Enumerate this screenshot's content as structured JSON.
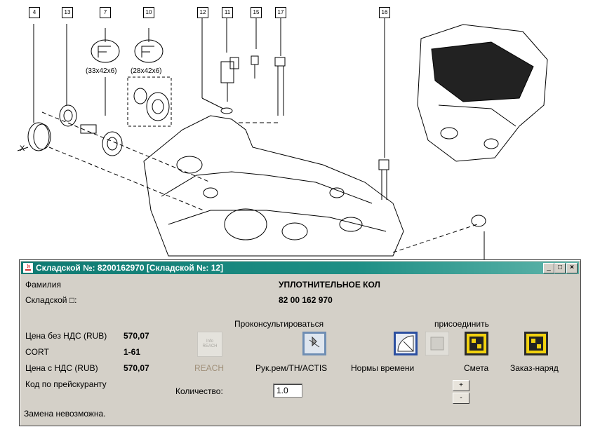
{
  "diagram": {
    "callouts": [
      "4",
      "13",
      "7",
      "10",
      "12",
      "11",
      "15",
      "17",
      "16"
    ],
    "seal_sizes": [
      "(33x42x6)",
      "(28x42x6)"
    ],
    "view_label": "X"
  },
  "dialog": {
    "title": "Складской №: 8200162970 [Складской №: 12]",
    "controls": {
      "minimize": "_",
      "maximize": "□",
      "close": "×"
    },
    "name_label": "Фамилия",
    "name_value": "УПЛОТНИТЕЛЬНОЕ КОЛ",
    "stock_label": "Складской □:",
    "stock_value": "82 00 162 970",
    "price_excl_label": "Цена без НДС (RUB)",
    "price_excl_value": "570,07",
    "cort_label": "CORT",
    "cort_value": "1-61",
    "price_incl_label": "Цена с НДС (RUB)",
    "price_incl_value": "570,07",
    "pricelist_code_label": "Код по прейскуранту",
    "consult_label": "Проконсультироваться",
    "attach_label": "присоединить",
    "reach_label": "REACH",
    "reach_icon_text": "Info REACH",
    "manual_label": "Рук.рем/TH/ACTIS",
    "labor_label": "Нормы времени",
    "estimate_label": "Смета",
    "order_label": "Заказ-наряд",
    "quantity_label": "Количество:",
    "quantity_value": "1.0",
    "plus": "+",
    "minus": "-",
    "status": "Замена невозможна."
  },
  "colors": {
    "title_bar": "#1e8f85",
    "dialog_bg": "#d4d0c8",
    "reach_disabled": "#a0907a"
  }
}
